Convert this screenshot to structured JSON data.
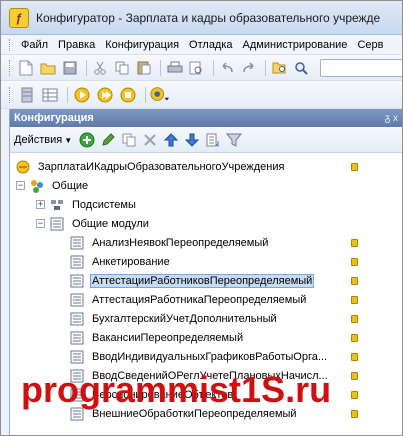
{
  "window": {
    "title": "Конфигуратор - Зарплата и кадры образовательного учрежде"
  },
  "menu": [
    {
      "label": "Файл"
    },
    {
      "label": "Правка"
    },
    {
      "label": "Конфигурация"
    },
    {
      "label": "Отладка"
    },
    {
      "label": "Администрирование"
    },
    {
      "label": "Серв"
    }
  ],
  "toolbar1_icons": [
    "new-document-icon",
    "open-folder-icon",
    "save-icon",
    "cut-icon",
    "copy-icon",
    "paste-icon",
    "print-icon",
    "print-preview-icon",
    "undo-icon",
    "redo-icon",
    "find-in-tree-icon",
    "search-field"
  ],
  "toolbar2_icons": [
    "database-icon",
    "table-icon",
    "run-debug-icon",
    "run-enterprise-icon",
    "run-thin-client-icon",
    "run-options-icon"
  ],
  "panel": {
    "title": "Конфигурация",
    "pin": "ᵹ x",
    "actions_label": "Действия",
    "toolbar_icons": [
      "add-icon",
      "edit-icon",
      "copy-icon",
      "delete-icon",
      "move-up-icon",
      "move-down-icon",
      "sort-icon",
      "filter-icon"
    ]
  },
  "tree": {
    "root": "ЗарплатаИКадрыОбразовательногоУчреждения",
    "general": "Общие",
    "subsystems": "Подсистемы",
    "common_modules": "Общие модули",
    "modules": [
      "АнализНеявокПереопределяемый",
      "Анкетирование",
      "АттестацииРаботниковПереопределяемый",
      "АттестацияРаботникаПереопределяемый",
      "БухгалтерскийУчетДополнительный",
      "ВакансииПереопределяемый",
      "ВводИндивидуальныхГрафиковРаботыОрга...",
      "ВводСведенийОРеглУчетеПлановыхНачисл...",
      "ВерсионированиеОбъектов",
      "ВнешниеОбработкиПереопределяемый"
    ]
  },
  "watermark": "programmist1S.ru"
}
